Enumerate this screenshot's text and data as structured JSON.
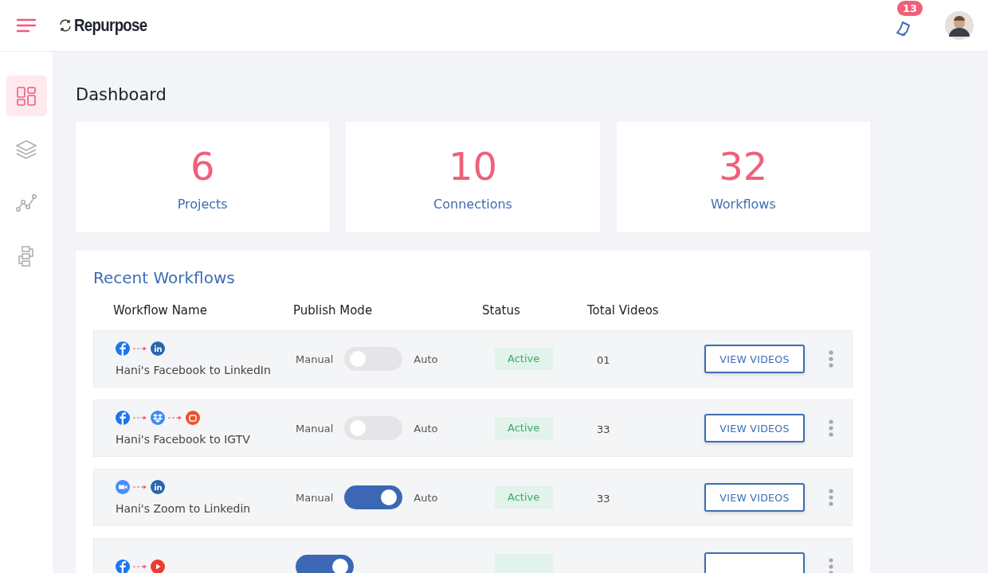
{
  "header": {
    "logo": "Repurpose",
    "notifications": "13"
  },
  "sidebar": {
    "items": [
      {
        "kind": "dashboard",
        "selected": true
      },
      {
        "kind": "layers",
        "selected": false
      },
      {
        "kind": "graph",
        "selected": false
      },
      {
        "kind": "flow",
        "selected": false
      }
    ]
  },
  "page_title": "Dashboard",
  "stats": [
    {
      "value": "6",
      "label": "Projects"
    },
    {
      "value": "10",
      "label": "Connections"
    },
    {
      "value": "32",
      "label": "Workflows"
    }
  ],
  "recent": {
    "title": "Recent Workflows",
    "columns": [
      "Workflow Name",
      "Publish Mode",
      "Status",
      "Total Videos"
    ],
    "rows": [
      {
        "services": [
          {
            "kind": "facebook"
          },
          {
            "kind": "linkedin"
          }
        ],
        "name": "Hani's Facebook to LinkedIn",
        "manual_label": "Manual",
        "auto_label": "Auto",
        "auto": false,
        "status": "Active",
        "total": "01",
        "button": "VIEW VIDEOS"
      },
      {
        "services": [
          {
            "kind": "facebook"
          },
          {
            "kind": "dropbox"
          },
          {
            "kind": "igtv"
          }
        ],
        "name": "Hani's Facebook to IGTV",
        "manual_label": "Manual",
        "auto_label": "Auto",
        "auto": false,
        "status": "Active",
        "total": "33",
        "button": "VIEW VIDEOS"
      },
      {
        "services": [
          {
            "kind": "zoom"
          },
          {
            "kind": "linkedin"
          }
        ],
        "name": "Hani's Zoom to Linkedin",
        "manual_label": "Manual",
        "auto_label": "Auto",
        "auto": true,
        "status": "Active",
        "total": "33",
        "button": "VIEW VIDEOS"
      },
      {
        "services": [
          {
            "kind": "facebook"
          },
          {
            "kind": "youtube"
          }
        ],
        "auto": true
      }
    ]
  }
}
